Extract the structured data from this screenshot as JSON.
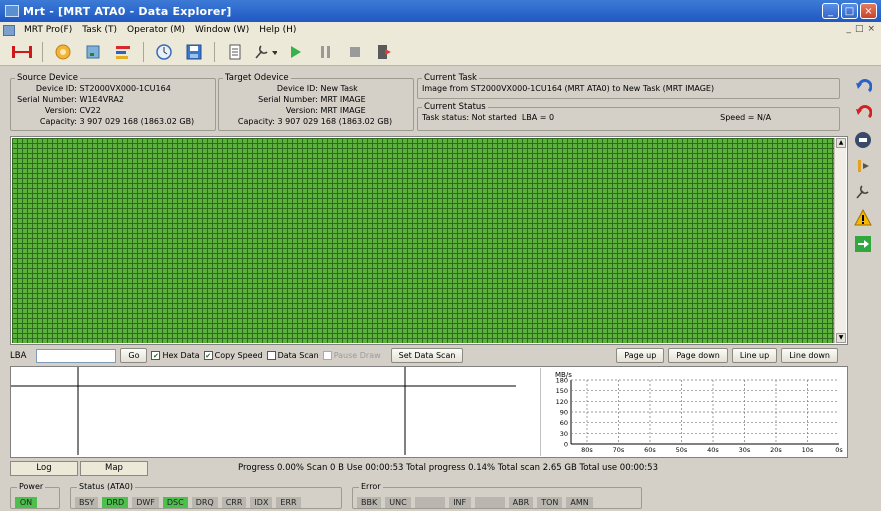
{
  "window": {
    "title": "Mrt - [MRT ATA0 - Data Explorer]",
    "controls": [
      "_",
      "□",
      "×"
    ]
  },
  "menu": {
    "items": [
      "MRT Pro(F)",
      "Task (T)",
      "Operator (M)",
      "Window (W)",
      "Help (H)"
    ],
    "mdi_controls": [
      "_",
      "□",
      "×"
    ]
  },
  "toolbar": {
    "icons": [
      "connect-icon",
      "settings-gear-icon",
      "device-icon",
      "chart-icon",
      "clock-icon",
      "save-icon",
      "document-icon",
      "tool-dropdown-icon",
      "play-icon",
      "pause-icon",
      "stop-icon",
      "exit-icon"
    ]
  },
  "source_device": {
    "legend": "Source Device",
    "device_id_label": "Device ID:",
    "device_id": "ST2000VX000-1CU164",
    "serial_label": "Serial Number:",
    "serial": "W1E4VRA2",
    "version_label": "Version:",
    "version": "CV22",
    "capacity_label": "Capacity:",
    "capacity": "3 907 029 168 (1863.02 GB)"
  },
  "target_device": {
    "legend": "Target Odevice",
    "device_id_label": "Device ID:",
    "device_id": "New Task",
    "serial_label": "Serial Number:",
    "serial": "MRT IMAGE",
    "version_label": "Version:",
    "version": "MRT IMAGE",
    "capacity_label": "Capacity:",
    "capacity": "3 907 029 168 (1863.02 GB)"
  },
  "current_task": {
    "legend": "Current Task",
    "text": "Image from ST2000VX000-1CU164 (MRT ATA0) to New Task (MRT IMAGE)"
  },
  "current_status": {
    "legend": "Current Status",
    "task_status": "Task status: Not started",
    "lba": "LBA = 0",
    "speed": "Speed = N/A"
  },
  "side_icons": [
    "undo-blue-icon",
    "undo-red-icon",
    "disk-icon",
    "move-icon",
    "tool-icon",
    "warning-icon",
    "arrow-right-icon"
  ],
  "grid": {
    "block_color": "#5cb33c"
  },
  "lba_bar": {
    "lba_label": "LBA",
    "lba_value": "",
    "go": "Go",
    "hex_data": "Hex Data",
    "hex_checked": "✔",
    "copy_speed": "Copy Speed",
    "copy_checked": "✔",
    "data_scan": "Data Scan",
    "pause_draw": "Pause Draw",
    "set_data_scan": "Set Data Scan",
    "page_up": "Page up",
    "page_down": "Page down",
    "line_up": "Line up",
    "line_down": "Line down"
  },
  "speed_chart": {
    "unit": "MB/s",
    "y_ticks": [
      "180",
      "150",
      "120",
      "90",
      "60",
      "30",
      "0"
    ],
    "x_ticks": [
      "80s",
      "70s",
      "60s",
      "50s",
      "40s",
      "30s",
      "20s",
      "10s",
      "0s"
    ]
  },
  "chart_data": {
    "type": "line",
    "ylabel": "MB/s",
    "ylim": [
      0,
      180
    ],
    "x": [
      "80s",
      "70s",
      "60s",
      "50s",
      "40s",
      "30s",
      "20s",
      "10s",
      "0s"
    ],
    "series": [],
    "grid": true
  },
  "tabs": {
    "log": "Log",
    "map": "Map"
  },
  "progress": {
    "text": "Progress 0.00% Scan 0 B Use 00:00:53   Total progress 0.14% Total scan 2.65 GB Total use 00:00:53"
  },
  "status": {
    "power_label": "Power",
    "power_on": "ON",
    "ata_label": "Status (ATA0)",
    "ata_flags": [
      "BSY",
      "DRD",
      "DWF",
      "DSC",
      "DRQ",
      "CRR",
      "IDX",
      "ERR"
    ],
    "error_label": "Error",
    "error_flags": [
      "BBK",
      "UNC",
      "",
      "INF",
      "",
      "ABR",
      "TON",
      "AMN"
    ]
  }
}
